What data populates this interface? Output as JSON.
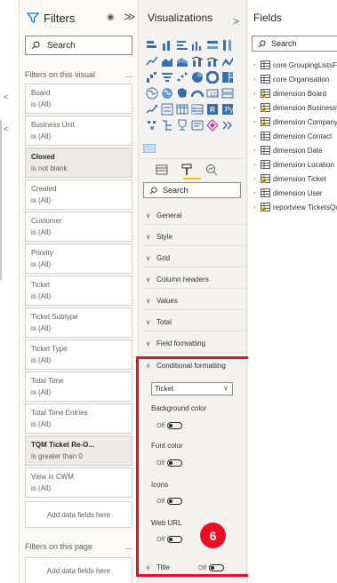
{
  "filters_pane": {
    "title": "Filters",
    "search_placeholder": "Search",
    "section_visual": "Filters on this visual",
    "section_page": "Filters on this page",
    "more": "...",
    "cards": [
      {
        "name": "Board",
        "value": "is (All)",
        "bold": false
      },
      {
        "name": "Business Unit",
        "value": "is (All)",
        "bold": false
      },
      {
        "name": "Closed",
        "value": "is not blank",
        "bold": true
      },
      {
        "name": "Created",
        "value": "is (All)",
        "bold": false
      },
      {
        "name": "Customer",
        "value": "is (All)",
        "bold": false
      },
      {
        "name": "Priority",
        "value": "is (All)",
        "bold": false
      },
      {
        "name": "Ticket",
        "value": "is (All)",
        "bold": false
      },
      {
        "name": "Ticket Subtype",
        "value": "is (All)",
        "bold": false
      },
      {
        "name": "Ticket Type",
        "value": "is (All)",
        "bold": false
      },
      {
        "name": "Total Time",
        "value": "is (All)",
        "bold": false
      },
      {
        "name": "Total Time Entries",
        "value": "is (All)",
        "bold": false
      },
      {
        "name": "TQM Ticket Re-O...",
        "value": "is greater than 0",
        "bold": true
      },
      {
        "name": "View in CWM",
        "value": "is (All)",
        "bold": false
      }
    ],
    "add_fields": "Add data fields here",
    "add_fields_page": "Add data fields here"
  },
  "viz_pane": {
    "title": "Visualizations",
    "search_placeholder": "Search",
    "sections": [
      {
        "label": "General",
        "expanded": false
      },
      {
        "label": "Style",
        "expanded": false
      },
      {
        "label": "Grid",
        "expanded": false
      },
      {
        "label": "Column headers",
        "expanded": false
      },
      {
        "label": "Values",
        "expanded": false
      },
      {
        "label": "Total",
        "expanded": false
      },
      {
        "label": "Field formatting",
        "expanded": false
      },
      {
        "label": "Conditional formatting",
        "expanded": true
      }
    ],
    "conditional": {
      "field_select": "Ticket",
      "options": [
        {
          "label": "Background color",
          "state": "Off"
        },
        {
          "label": "Font color",
          "state": "Off"
        },
        {
          "label": "Icons",
          "state": "Off"
        },
        {
          "label": "Web URL",
          "state": "Off"
        }
      ]
    },
    "title_section": {
      "label": "Title",
      "state": "Off"
    },
    "callout": "6",
    "highlight_color": "#e81123",
    "accent_color": "#f2c811"
  },
  "fields_pane": {
    "title": "Fields",
    "search_placeholder": "Search",
    "tables": [
      {
        "name": "core GroupingListsFo",
        "checked": false
      },
      {
        "name": "core Organisation",
        "checked": false
      },
      {
        "name": "dimension Board",
        "checked": true
      },
      {
        "name": "dimension BusinessU",
        "checked": true
      },
      {
        "name": "dimension Company",
        "checked": true
      },
      {
        "name": "dimension Contact",
        "checked": false
      },
      {
        "name": "dimension Date",
        "checked": false
      },
      {
        "name": "dimension Location",
        "checked": false
      },
      {
        "name": "dimension Ticket",
        "checked": true
      },
      {
        "name": "dimension User",
        "checked": false
      },
      {
        "name": "reportview TicketsQu",
        "checked": true
      }
    ]
  }
}
